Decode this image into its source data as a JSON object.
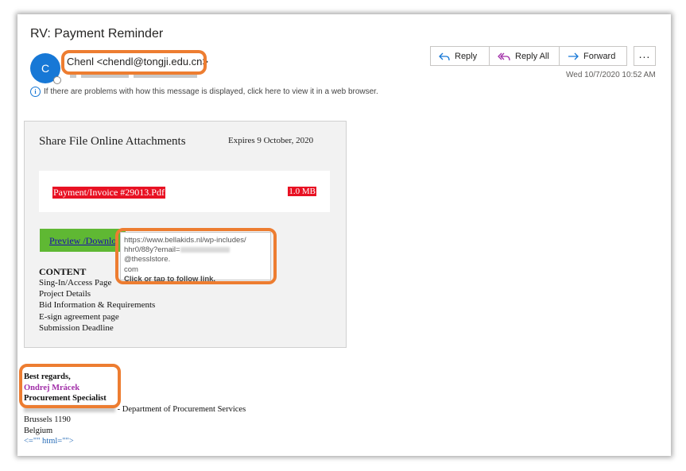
{
  "email": {
    "subject": "RV: Payment Reminder",
    "avatar_initial": "C",
    "sender": "Chenl <chendl@tongji.edu.cn>",
    "info_text": "If there are problems with how this message is displayed, click here to view it in a web browser.",
    "date": "Wed 10/7/2020 10:52 AM"
  },
  "actions": {
    "reply": "Reply",
    "reply_all": "Reply All",
    "forward": "Forward",
    "more": "..."
  },
  "card": {
    "title": "Share File Online Attachments",
    "expires": "Expires 9 October, 2020",
    "file_name": "Payment/Invoice #29013.Pdf",
    "file_size": "1.0 MB",
    "preview_label": "Preview /Downlo",
    "content_heading": "CONTENT",
    "content_items": [
      "Sing-In/Access Page",
      "Project Details",
      "Bid Information & Requirements",
      "E-sign agreement page",
      "Submission Deadline"
    ]
  },
  "tooltip": {
    "url_line1": "https://www.bellakids.nl/wp-includes/",
    "url_line2_prefix": "hhr0/88y?email=",
    "url_line2_suffix": "@thesslstore.",
    "url_line3": "com",
    "cta": "Click or tap to follow link."
  },
  "signature": {
    "closing": "Best regards,",
    "name": "Ondrej Mrácek",
    "role": "Procurement Specialist",
    "department_suffix": "- Department of Procurement Services",
    "city": "Brussels 1190",
    "country": "Belgium",
    "html_fragment": "<=\"\" html=\"\">"
  },
  "colors": {
    "highlight": "#ed7d31",
    "file_bar": "#e81123",
    "preview_button": "#5fb833",
    "avatar": "#1778d6"
  }
}
